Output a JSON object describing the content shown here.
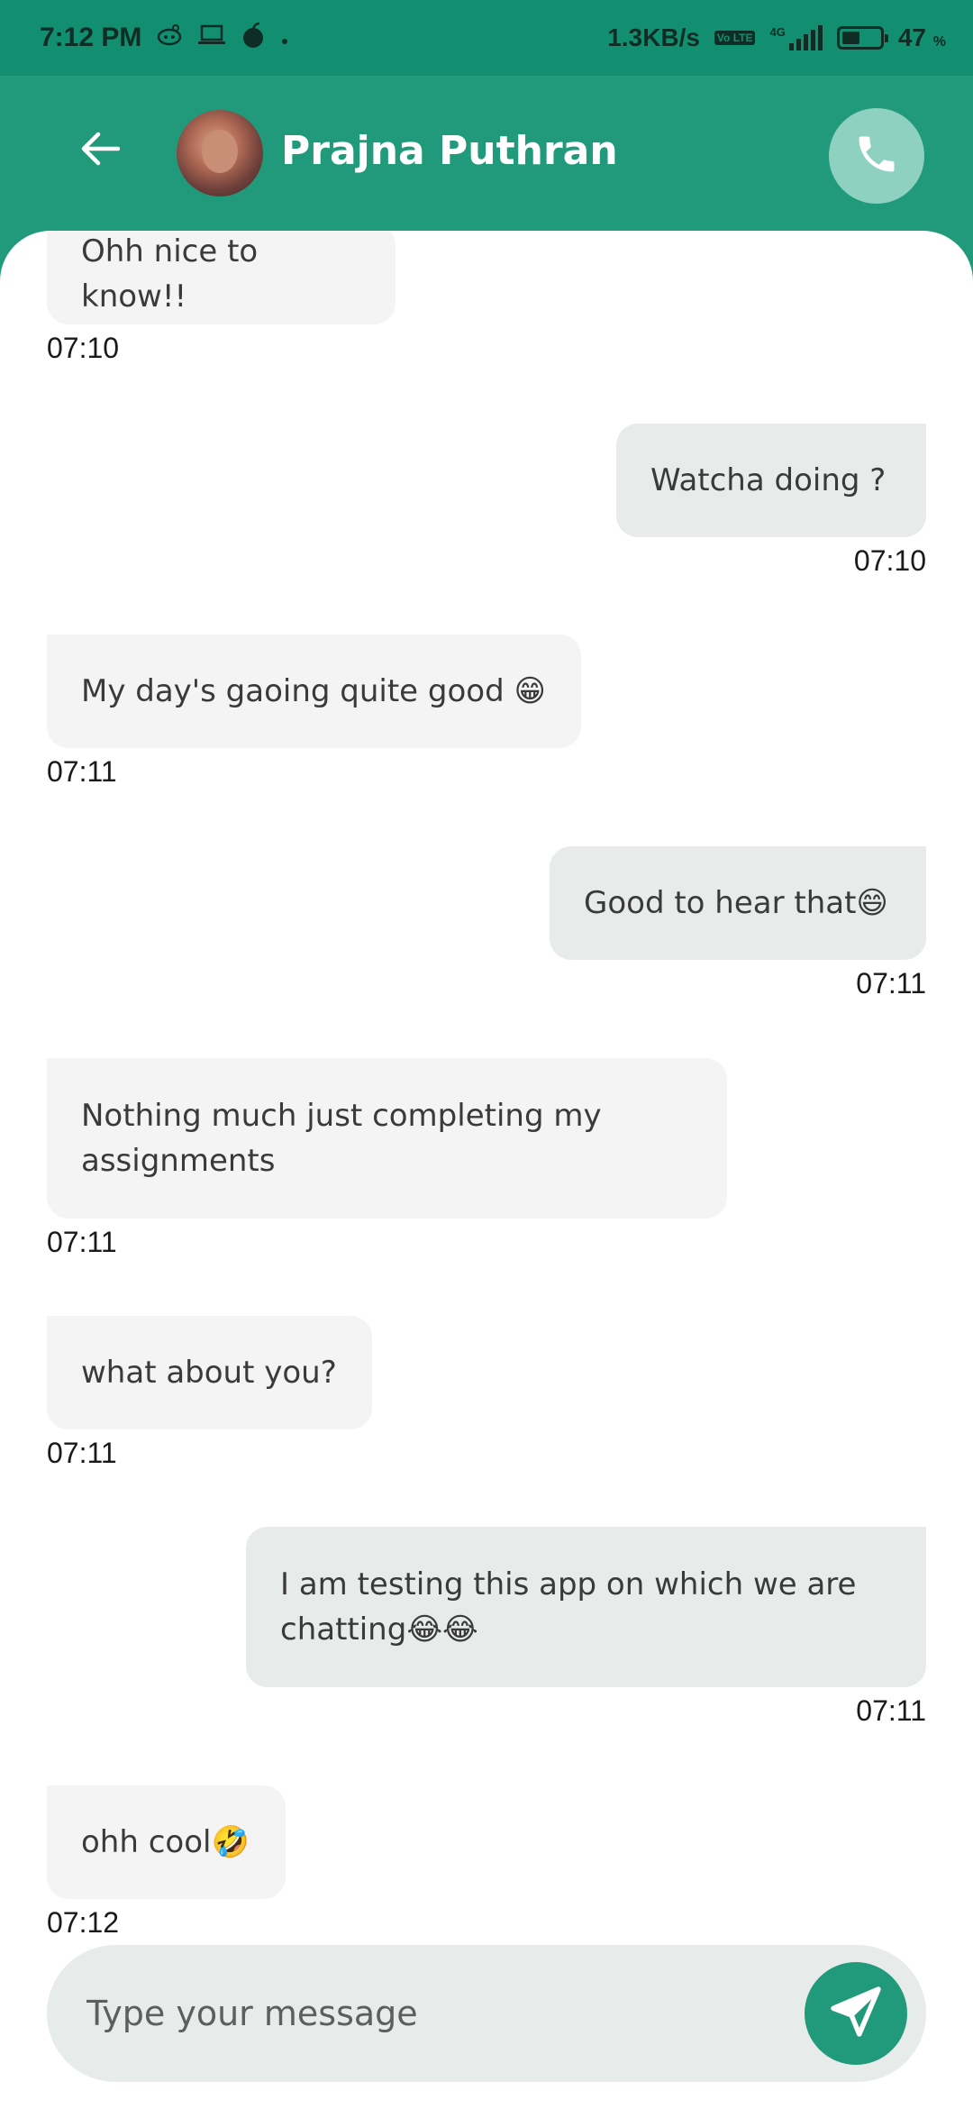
{
  "status_bar": {
    "time": "7:12 PM",
    "network_speed": "1.3KB/s",
    "volte": "Vo LTE",
    "network_type": "4G",
    "battery_percent": "47",
    "battery_unit": "%",
    "battery_level": 0.47,
    "icons": [
      "app-notification-icon",
      "laptop-icon",
      "apple-icon",
      "dot-icon"
    ]
  },
  "header": {
    "contact_name": "Prajna Puthran",
    "background_color": "#219a7b",
    "status_bar_color": "#128f71"
  },
  "messages": [
    {
      "direction": "in",
      "text": "Ohh nice to know!!",
      "time": "07:10"
    },
    {
      "direction": "out",
      "text": "Watcha doing ?",
      "time": "07:10"
    },
    {
      "direction": "in",
      "text": "My day's gaoing quite good 😁",
      "time": "07:11"
    },
    {
      "direction": "out",
      "text": "Good to hear that😄",
      "time": "07:11"
    },
    {
      "direction": "in",
      "text": "Nothing much just completing my assignments",
      "time": "07:11"
    },
    {
      "direction": "in",
      "text": "what about you?",
      "time": "07:11"
    },
    {
      "direction": "out",
      "text": "I am testing this app on which we are chatting😂😂",
      "time": "07:11"
    },
    {
      "direction": "in",
      "text": "ohh cool🤣",
      "time": "07:12"
    }
  ],
  "composer": {
    "placeholder": "Type your message",
    "value": ""
  },
  "colors": {
    "incoming_bubble": "#f4f4f4",
    "outgoing_bubble": "#e7ecea",
    "send_button": "#219a7b",
    "call_button": "#8fd1c0"
  }
}
